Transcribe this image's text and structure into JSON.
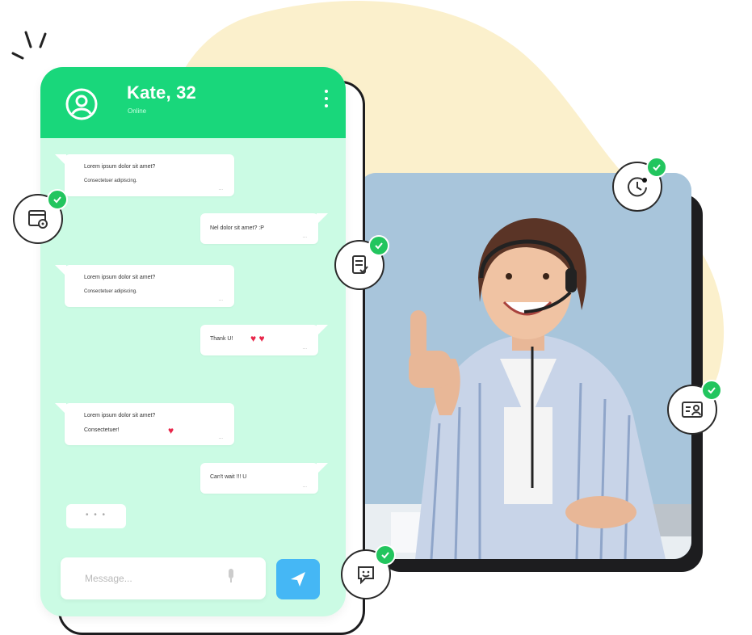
{
  "chat": {
    "name": "Kate, 32",
    "status": "Online",
    "messages": [
      {
        "dir": "in",
        "line1": "Lorem ipsum dolor sit amet?",
        "line2": "Consectetuer adipiscing.",
        "meta": "...."
      },
      {
        "dir": "out",
        "line1": "Nel dolor sit amet? :P",
        "meta": "...."
      },
      {
        "dir": "in",
        "line1": "Lorem ipsum dolor sit amet?",
        "line2": "Consectetuer adipiscing.",
        "meta": "...."
      },
      {
        "dir": "out",
        "line1": "Thank U!",
        "meta": "...."
      },
      {
        "dir": "in",
        "line1": "Lorem ipsum dolor sit amet?",
        "line2": "Consectetuer!",
        "meta": "...."
      },
      {
        "dir": "out",
        "line1": "Can't wait !!! U",
        "meta": "...."
      }
    ],
    "typing": "• • •",
    "composer_placeholder": "Message..."
  },
  "icons": {
    "avatar": "user-circle-icon",
    "menu": "kebab-menu-icon",
    "mic": "microphone-icon",
    "send": "send-icon",
    "badges": [
      "browser-settings-icon",
      "checklist-document-icon",
      "clock-icon",
      "id-card-icon",
      "chat-smile-icon"
    ]
  },
  "colors": {
    "header": "#19d77b",
    "chat_bg": "#cbfbe4",
    "send": "#45b7f5",
    "heart": "#e8264a",
    "check": "#22c55e",
    "blob": "#fbf0cc"
  }
}
